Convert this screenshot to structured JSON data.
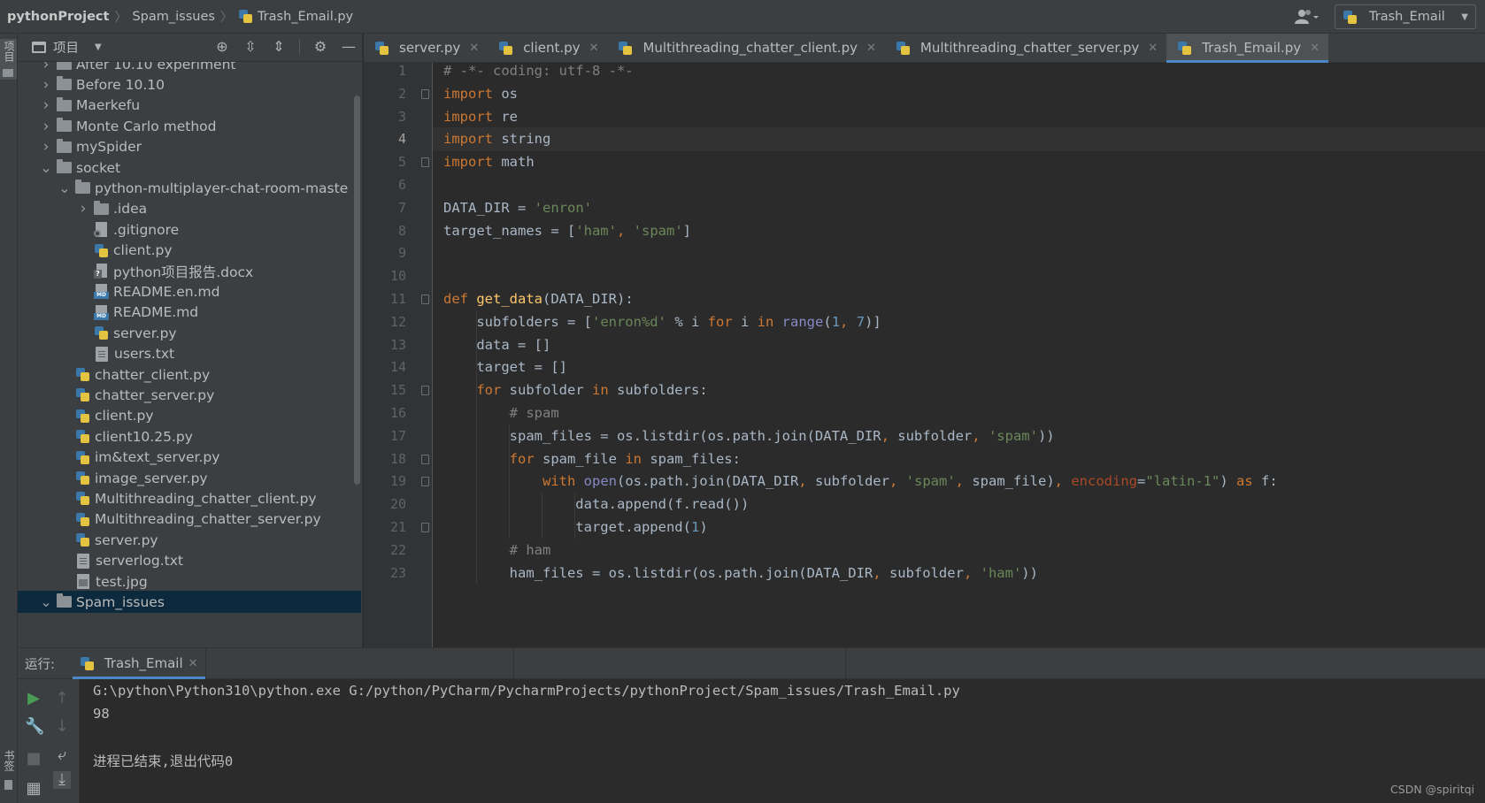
{
  "breadcrumb": {
    "project": "pythonProject",
    "folder": "Spam_issues",
    "file": "Trash_Email.py"
  },
  "run_config": {
    "label": "Trash_Email"
  },
  "left_stripe": {
    "project_label": "项目",
    "bookmark_label": "书签"
  },
  "project_panel": {
    "title": "项目",
    "tree": [
      {
        "label": "After 10.10 experiment",
        "type": "folder",
        "expanded": false,
        "depth": 1
      },
      {
        "label": "Before 10.10",
        "type": "folder",
        "expanded": false,
        "depth": 1
      },
      {
        "label": "Maerkefu",
        "type": "folder",
        "expanded": false,
        "depth": 1
      },
      {
        "label": "Monte Carlo method",
        "type": "folder",
        "expanded": false,
        "depth": 1
      },
      {
        "label": "mySpider",
        "type": "folder",
        "expanded": false,
        "depth": 1
      },
      {
        "label": "socket",
        "type": "folder",
        "expanded": true,
        "depth": 1
      },
      {
        "label": "python-multiplayer-chat-room-maste",
        "type": "folder",
        "expanded": true,
        "depth": 2
      },
      {
        "label": ".idea",
        "type": "folder",
        "expanded": false,
        "depth": 3
      },
      {
        "label": ".gitignore",
        "type": "git",
        "depth": 3
      },
      {
        "label": "client.py",
        "type": "py",
        "depth": 3
      },
      {
        "label": "python项目报告.docx",
        "type": "doc",
        "depth": 3
      },
      {
        "label": "README.en.md",
        "type": "md",
        "depth": 3
      },
      {
        "label": "README.md",
        "type": "md",
        "depth": 3
      },
      {
        "label": "server.py",
        "type": "py",
        "depth": 3
      },
      {
        "label": "users.txt",
        "type": "txt",
        "depth": 3
      },
      {
        "label": "chatter_client.py",
        "type": "py",
        "depth": 2
      },
      {
        "label": "chatter_server.py",
        "type": "py",
        "depth": 2
      },
      {
        "label": "client.py",
        "type": "py",
        "depth": 2
      },
      {
        "label": "client10.25.py",
        "type": "py",
        "depth": 2
      },
      {
        "label": "im&text_server.py",
        "type": "py",
        "depth": 2
      },
      {
        "label": "image_server.py",
        "type": "py",
        "depth": 2
      },
      {
        "label": "Multithreading_chatter_client.py",
        "type": "py",
        "depth": 2
      },
      {
        "label": "Multithreading_chatter_server.py",
        "type": "py",
        "depth": 2
      },
      {
        "label": "server.py",
        "type": "py",
        "depth": 2
      },
      {
        "label": "serverlog.txt",
        "type": "txt",
        "depth": 2
      },
      {
        "label": "test.jpg",
        "type": "img",
        "depth": 2
      },
      {
        "label": "Spam_issues",
        "type": "folder",
        "expanded": true,
        "depth": 1,
        "selected": true
      }
    ]
  },
  "tabs": [
    {
      "label": "server.py",
      "active": false
    },
    {
      "label": "client.py",
      "active": false
    },
    {
      "label": "Multithreading_chatter_client.py",
      "active": false
    },
    {
      "label": "Multithreading_chatter_server.py",
      "active": false
    },
    {
      "label": "Trash_Email.py",
      "active": true
    }
  ],
  "editor": {
    "current_line": 4,
    "lines": [
      "# -*- coding: utf-8 -*-",
      "import os",
      "import re",
      "import string",
      "import math",
      "",
      "DATA_DIR = 'enron'",
      "target_names = ['ham', 'spam']",
      "",
      "",
      "def get_data(DATA_DIR):",
      "    subfolders = ['enron%d' % i for i in range(1, 7)]",
      "    data = []",
      "    target = []",
      "    for subfolder in subfolders:",
      "        # spam",
      "        spam_files = os.listdir(os.path.join(DATA_DIR, subfolder, 'spam'))",
      "        for spam_file in spam_files:",
      "            with open(os.path.join(DATA_DIR, subfolder, 'spam', spam_file), encoding=\"latin-1\") as f:",
      "                data.append(f.read())",
      "                target.append(1)",
      "        # ham",
      "        ham_files = os.listdir(os.path.join(DATA_DIR, subfolder, 'ham'))"
    ]
  },
  "run_panel": {
    "label": "运行:",
    "tab": "Trash_Email",
    "output": [
      "G:\\python\\Python310\\python.exe G:/python/PyCharm/PycharmProjects/pythonProject/Spam_issues/Trash_Email.py",
      "98",
      "",
      "进程已结束,退出代码0"
    ]
  },
  "watermark": "CSDN @spiritqi",
  "colors": {
    "accent": "#4a88c7",
    "keyword": "#cc7832",
    "string": "#6a8759",
    "number": "#6897bb",
    "comment": "#808080",
    "function": "#ffc66d"
  }
}
